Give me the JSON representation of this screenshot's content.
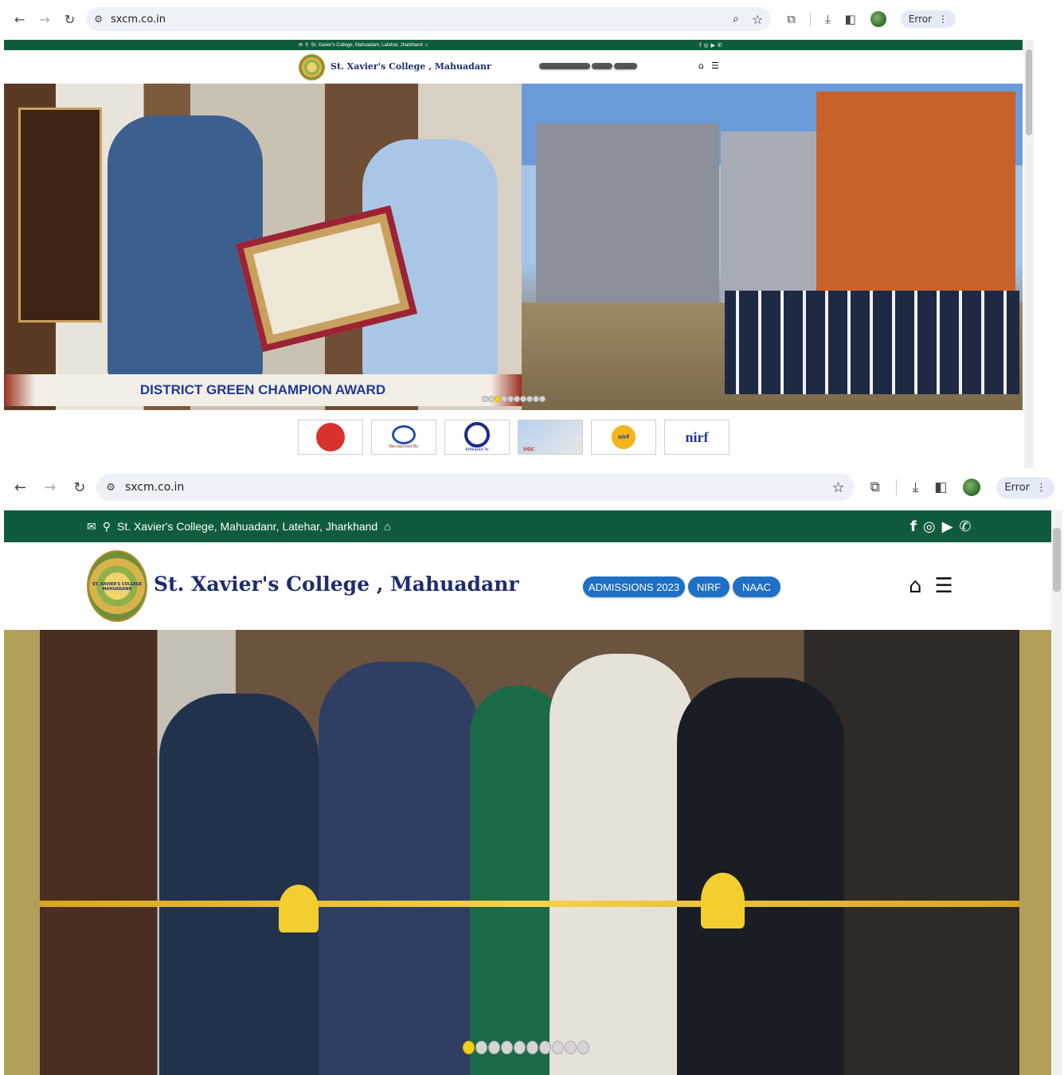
{
  "browser": {
    "url": "sxcm.co.in",
    "error_label": "Error"
  },
  "site": {
    "address": "St. Xavier's College, Mahuadanr, Latehar, Jharkhand",
    "college_name": "St. Xavier's College , Mahuadanr",
    "logo_text": "ST. XAVIER'S COLLEGE MAHUADANR",
    "nav_pills": [
      "ADMISSIONS 2023",
      "NIRF",
      "NAAC"
    ]
  },
  "slide_a": {
    "caption": "DISTRICT GREEN CHAMPION AWARD",
    "dots_total": 10,
    "active_dot": 2
  },
  "slide_b": {
    "dots_total": 10,
    "active_dot": 0
  },
  "accreditation_badges": [
    "gov-india-icon",
    "aicte-icon",
    "university-icon",
    "ugc-icon",
    "nirf-award-icon",
    "nirf-icon"
  ],
  "badge_texts": {
    "aicte": "Recognized By",
    "university": "Affiliated To",
    "ugc": "UGC",
    "nirf_award": "nirf",
    "nirf": "nirf"
  }
}
